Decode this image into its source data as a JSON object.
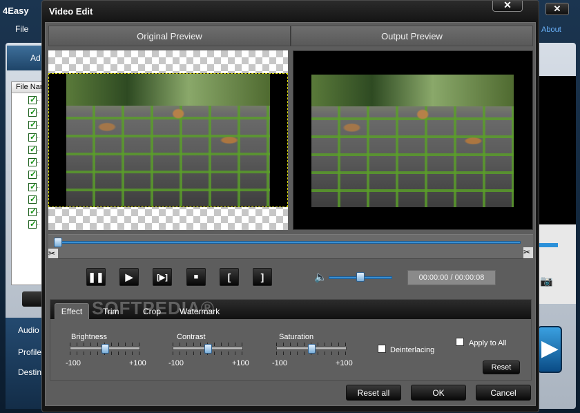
{
  "app": {
    "title": "4Easy",
    "menu_file": "File",
    "menu_about": "About",
    "tab_partial": "Ad",
    "filelist_header": "File Nar",
    "settings": [
      "Audio",
      "Profile",
      "Destin"
    ],
    "file_rows": 11
  },
  "dialog": {
    "title": "Video Edit",
    "close_label": "✕",
    "original_preview_label": "Original Preview",
    "output_preview_label": "Output Preview",
    "playback": {
      "time_display": "00:00:00 / 00:00:08",
      "volume_level_percent": 50,
      "position_percent": 0,
      "buttons": {
        "pause_label": "❚❚",
        "step_label": "▶",
        "play_clip_label": "[▶]",
        "stop_label": "■",
        "mark_in_label": "[",
        "mark_out_label": "]"
      }
    },
    "tabs": [
      "Effect",
      "Trim",
      "Crop",
      "Watermark"
    ],
    "active_tab": "Effect",
    "watermark_text": "SOFTPEDIA®",
    "effect": {
      "brightness": {
        "label": "Brightness",
        "min": "-100",
        "max": "+100",
        "value": 0
      },
      "contrast": {
        "label": "Contrast",
        "min": "-100",
        "max": "+100",
        "value": 0
      },
      "saturation": {
        "label": "Saturation",
        "min": "-100",
        "max": "+100",
        "value": 0
      },
      "deinterlacing_label": "Deinterlacing",
      "deinterlacing_checked": false,
      "apply_to_all_label": "Apply to All",
      "apply_to_all_checked": false,
      "reset_label": "Reset"
    },
    "footer": {
      "reset_all_label": "Reset all",
      "ok_label": "OK",
      "cancel_label": "Cancel"
    }
  },
  "colors": {
    "accent_blue": "#3a8ed0",
    "dialog_bg": "#5d5d5d",
    "crop_border": "#d7d700"
  }
}
